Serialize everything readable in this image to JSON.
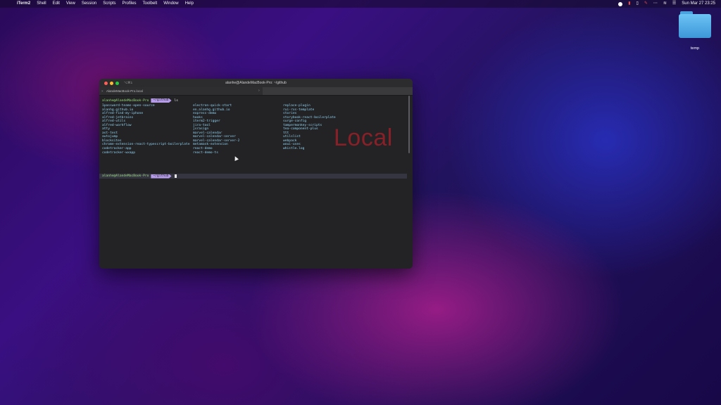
{
  "menubar": {
    "apple_icon": "apple-icon",
    "items": [
      "iTerm2",
      "Shell",
      "Edit",
      "View",
      "Session",
      "Scripts",
      "Profiles",
      "Toolbelt",
      "Window",
      "Help"
    ],
    "clock": "Sun Mar 27  23:25",
    "status_icons": [
      "record-icon",
      "flag-icon",
      "battery-icon",
      "pen-icon",
      "ellipsis-icon",
      "wifi-icon",
      "menu-extras-icon"
    ]
  },
  "desktop": {
    "folder_label": "temp"
  },
  "terminal": {
    "shortcut": "⌥⌘1",
    "title": "alanhe@AlandeMacBook-Pro: ~/github",
    "tab_label": "AlandeMacBook-Pro.local",
    "prompt": {
      "user": "alanhe@AlandeMacBook-Pro",
      "dir": "~/github",
      "command": "ls"
    },
    "listing": {
      "col1": [
        "1password-teams-open-source",
        "alanhg.github.io",
        "alfred-find-my-iphone",
        "alfred-jetbrains",
        "alfred-utils",
        "alfred-workflow",
        "atty",
        "ast-test",
        "autojump",
        "blocksites",
        "chrome-extension-react-typescript-boilerplate",
        "codetracker-app",
        "codetracker-wxapp"
      ],
      "col2": [
        "electron-quick-start",
        "en.alanhg.github.io",
        "express-demo",
        "hooks",
        "iterm2-trigger",
        "jira-tool",
        "jsrasign",
        "marvel-calendar",
        "marvel-calendar-server",
        "marvel-calendar-server-2",
        "metamask-extension",
        "react-demo",
        "react-demo-ts"
      ],
      "col3": [
        "replace-plugin",
        "rui-rxs-template",
        "stories",
        "storybook-react-boilerplate",
        "surge-config",
        "tampermonkey-scripts",
        "tea-component-plus",
        "ttt",
        "utilslist",
        "webpack",
        "woui-uses",
        "whistle.log",
        ""
      ]
    },
    "watermark": "Local",
    "prompt2": {
      "user": "alanhe@AlandeMacBook-Pro",
      "dir": "~/github"
    }
  }
}
